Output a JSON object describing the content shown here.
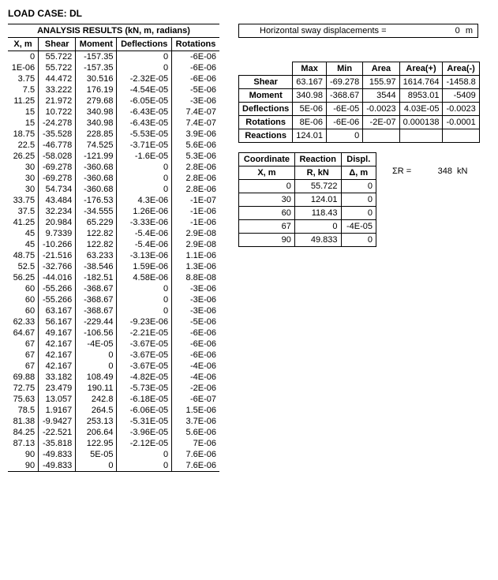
{
  "title": "LOAD CASE:  DL",
  "sway": {
    "label": "Horizontal sway displacements =",
    "value": "0",
    "unit": "m"
  },
  "main_table": {
    "caption": "ANALYSIS RESULTS (kN, m, radians)",
    "headers": [
      "X, m",
      "Shear",
      "Moment",
      "Deflections",
      "Rotations"
    ],
    "rows": [
      [
        "0",
        "55.722",
        "-157.35",
        "0",
        "-6E-06"
      ],
      [
        "1E-06",
        "55.722",
        "-157.35",
        "0",
        "-6E-06"
      ],
      [
        "3.75",
        "44.472",
        "30.516",
        "-2.32E-05",
        "-6E-06"
      ],
      [
        "7.5",
        "33.222",
        "176.19",
        "-4.54E-05",
        "-5E-06"
      ],
      [
        "11.25",
        "21.972",
        "279.68",
        "-6.05E-05",
        "-3E-06"
      ],
      [
        "15",
        "10.722",
        "340.98",
        "-6.43E-05",
        "7.4E-07"
      ],
      [
        "15",
        "-24.278",
        "340.98",
        "-6.43E-05",
        "7.4E-07"
      ],
      [
        "18.75",
        "-35.528",
        "228.85",
        "-5.53E-05",
        "3.9E-06"
      ],
      [
        "22.5",
        "-46.778",
        "74.525",
        "-3.71E-05",
        "5.6E-06"
      ],
      [
        "26.25",
        "-58.028",
        "-121.99",
        "-1.6E-05",
        "5.3E-06"
      ],
      [
        "30",
        "-69.278",
        "-360.68",
        "0",
        "2.8E-06"
      ],
      [
        "30",
        "-69.278",
        "-360.68",
        "0",
        "2.8E-06"
      ],
      [
        "30",
        "54.734",
        "-360.68",
        "0",
        "2.8E-06"
      ],
      [
        "33.75",
        "43.484",
        "-176.53",
        "4.3E-06",
        "-1E-07"
      ],
      [
        "37.5",
        "32.234",
        "-34.555",
        "1.26E-06",
        "-1E-06"
      ],
      [
        "41.25",
        "20.984",
        "65.229",
        "-3.33E-06",
        "-1E-06"
      ],
      [
        "45",
        "9.7339",
        "122.82",
        "-5.4E-06",
        "2.9E-08"
      ],
      [
        "45",
        "-10.266",
        "122.82",
        "-5.4E-06",
        "2.9E-08"
      ],
      [
        "48.75",
        "-21.516",
        "63.233",
        "-3.13E-06",
        "1.1E-06"
      ],
      [
        "52.5",
        "-32.766",
        "-38.546",
        "1.59E-06",
        "1.3E-06"
      ],
      [
        "56.25",
        "-44.016",
        "-182.51",
        "4.58E-06",
        "8.8E-08"
      ],
      [
        "60",
        "-55.266",
        "-368.67",
        "0",
        "-3E-06"
      ],
      [
        "60",
        "-55.266",
        "-368.67",
        "0",
        "-3E-06"
      ],
      [
        "60",
        "63.167",
        "-368.67",
        "0",
        "-3E-06"
      ],
      [
        "62.33",
        "56.167",
        "-229.44",
        "-9.23E-06",
        "-5E-06"
      ],
      [
        "64.67",
        "49.167",
        "-106.56",
        "-2.21E-05",
        "-6E-06"
      ],
      [
        "67",
        "42.167",
        "-4E-05",
        "-3.67E-05",
        "-6E-06"
      ],
      [
        "67",
        "42.167",
        "0",
        "-3.67E-05",
        "-6E-06"
      ],
      [
        "67",
        "42.167",
        "0",
        "-3.67E-05",
        "-4E-06"
      ],
      [
        "69.88",
        "33.182",
        "108.49",
        "-4.82E-05",
        "-4E-06"
      ],
      [
        "72.75",
        "23.479",
        "190.11",
        "-5.73E-05",
        "-2E-06"
      ],
      [
        "75.63",
        "13.057",
        "242.8",
        "-6.18E-05",
        "-6E-07"
      ],
      [
        "78.5",
        "1.9167",
        "264.5",
        "-6.06E-05",
        "1.5E-06"
      ],
      [
        "81.38",
        "-9.9427",
        "253.13",
        "-5.31E-05",
        "3.7E-06"
      ],
      [
        "84.25",
        "-22.521",
        "206.64",
        "-3.96E-05",
        "5.6E-06"
      ],
      [
        "87.13",
        "-35.818",
        "122.95",
        "-2.12E-05",
        "7E-06"
      ],
      [
        "90",
        "-49.833",
        "5E-05",
        "0",
        "7.6E-06"
      ],
      [
        "90",
        "-49.833",
        "0",
        "0",
        "7.6E-06"
      ]
    ]
  },
  "summary": {
    "headers": [
      "",
      "Max",
      "Min",
      "Area",
      "Area(+)",
      "Area(-)"
    ],
    "rows": [
      [
        "Shear",
        "63.167",
        "-69.278",
        "155.97",
        "1614.764",
        "-1458.8"
      ],
      [
        "Moment",
        "340.98",
        "-368.67",
        "3544",
        "8953.01",
        "-5409"
      ],
      [
        "Deflections",
        "5E-06",
        "-6E-05",
        "-0.0023",
        "4.03E-05",
        "-0.0023"
      ],
      [
        "Rotations",
        "8E-06",
        "-6E-06",
        "-2E-07",
        "0.000138",
        "-0.0001"
      ],
      [
        "Reactions",
        "124.01",
        "0",
        "",
        "",
        ""
      ]
    ]
  },
  "reaction": {
    "head1": [
      "Coordinate",
      "Reaction",
      "Displ."
    ],
    "head2": [
      "X, m",
      "R, kN",
      "Δ, m"
    ],
    "rows": [
      [
        "0",
        "55.722",
        "0"
      ],
      [
        "30",
        "124.01",
        "0"
      ],
      [
        "60",
        "118.43",
        "0"
      ],
      [
        "67",
        "0",
        "-4E-05"
      ],
      [
        "90",
        "49.833",
        "0"
      ]
    ]
  },
  "sigma": {
    "label": "ΣR =",
    "value": "348",
    "unit": "kN"
  }
}
